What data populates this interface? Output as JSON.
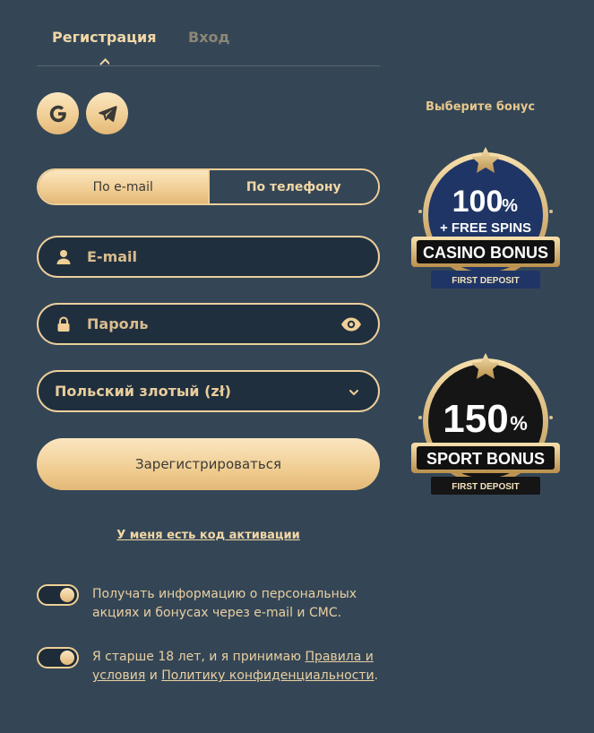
{
  "tabs": {
    "register": "Регистрация",
    "login": "Вход"
  },
  "social": {
    "google_icon": "google-icon",
    "telegram_icon": "telegram-icon"
  },
  "method": {
    "email": "По e-mail",
    "phone": "По телефону"
  },
  "form": {
    "email_placeholder": "E-mail",
    "password_placeholder": "Пароль",
    "currency": "Польский злотый (zł)",
    "submit": "Зарегистрироваться",
    "activation_link": "У меня есть код активации"
  },
  "consents": {
    "promo_text": "Получать информацию о персональных акциях и бонусах через e-mail и СМС.",
    "age_prefix": "Я старше 18 лет, и я принимаю ",
    "age_rules_link": "Правила и условия",
    "age_and": " и ",
    "age_privacy_link": "Политику конфиденциальности",
    "age_suffix": "."
  },
  "bonus": {
    "title": "Выберите бонус",
    "casino": {
      "percent": "100",
      "sign": "%",
      "spins": "+ FREE SPINS",
      "label": "CASINO BONUS",
      "sub": "FIRST DEPOSIT"
    },
    "sport": {
      "percent": "150",
      "sign": "%",
      "label": "SPORT BONUS",
      "sub": "FIRST DEPOSIT"
    }
  },
  "colors": {
    "background": "#344656",
    "gold": "#f0cf99",
    "field": "#202f3e"
  }
}
